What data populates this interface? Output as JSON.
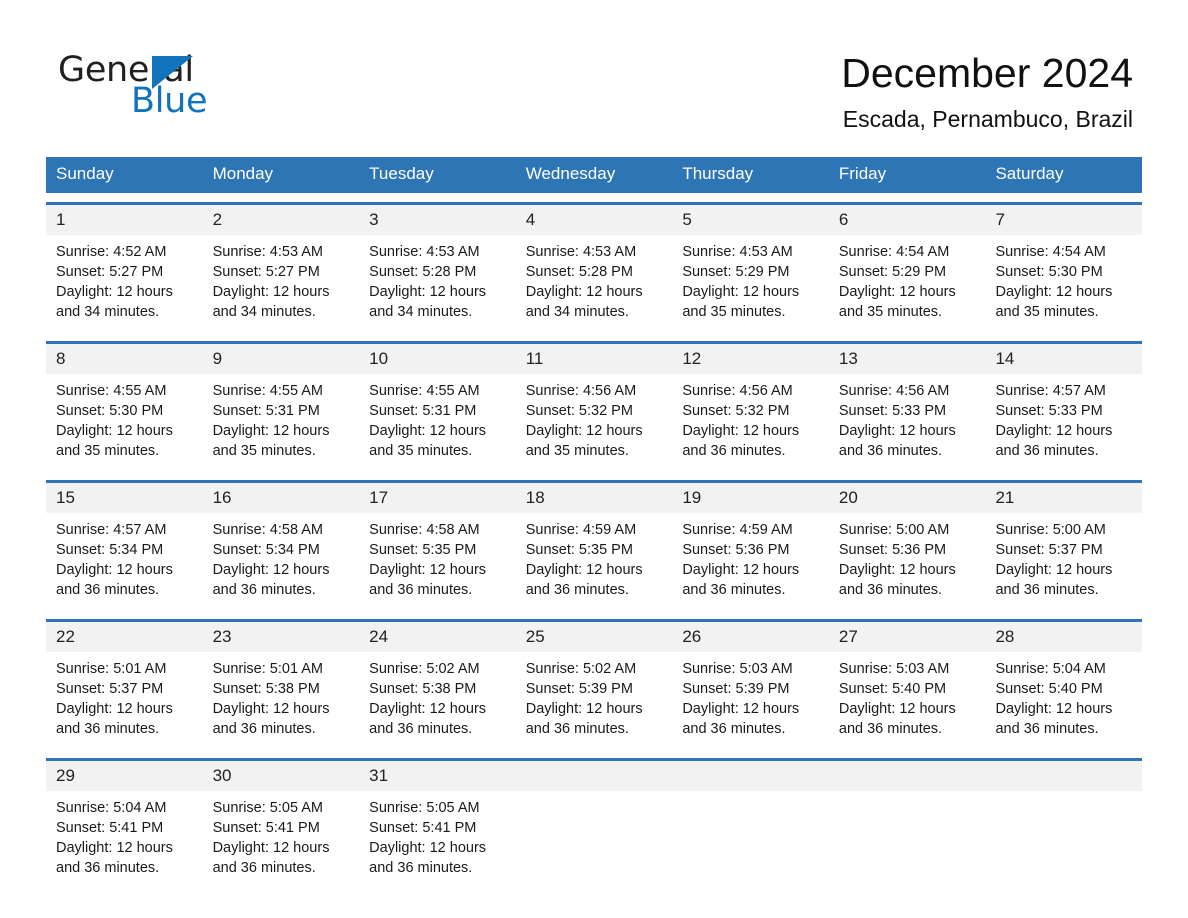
{
  "logo": {
    "word_black": "General",
    "word_blue": "Blue",
    "triangle_color": "#1273bd"
  },
  "header": {
    "title": "December 2024",
    "location": "Escada, Pernambuco, Brazil"
  },
  "theme": {
    "header_blue": "#2e75b6",
    "row_divider_blue": "#2e75b6",
    "date_band_gray": "#f2f2f2",
    "text_black": "#1a1a1a"
  },
  "weekdays": [
    "Sunday",
    "Monday",
    "Tuesday",
    "Wednesday",
    "Thursday",
    "Friday",
    "Saturday"
  ],
  "weeks": [
    [
      {
        "day": "1",
        "sunrise": "Sunrise: 4:52 AM",
        "sunset": "Sunset: 5:27 PM",
        "daylight_1": "Daylight: 12 hours",
        "daylight_2": "and 34 minutes."
      },
      {
        "day": "2",
        "sunrise": "Sunrise: 4:53 AM",
        "sunset": "Sunset: 5:27 PM",
        "daylight_1": "Daylight: 12 hours",
        "daylight_2": "and 34 minutes."
      },
      {
        "day": "3",
        "sunrise": "Sunrise: 4:53 AM",
        "sunset": "Sunset: 5:28 PM",
        "daylight_1": "Daylight: 12 hours",
        "daylight_2": "and 34 minutes."
      },
      {
        "day": "4",
        "sunrise": "Sunrise: 4:53 AM",
        "sunset": "Sunset: 5:28 PM",
        "daylight_1": "Daylight: 12 hours",
        "daylight_2": "and 34 minutes."
      },
      {
        "day": "5",
        "sunrise": "Sunrise: 4:53 AM",
        "sunset": "Sunset: 5:29 PM",
        "daylight_1": "Daylight: 12 hours",
        "daylight_2": "and 35 minutes."
      },
      {
        "day": "6",
        "sunrise": "Sunrise: 4:54 AM",
        "sunset": "Sunset: 5:29 PM",
        "daylight_1": "Daylight: 12 hours",
        "daylight_2": "and 35 minutes."
      },
      {
        "day": "7",
        "sunrise": "Sunrise: 4:54 AM",
        "sunset": "Sunset: 5:30 PM",
        "daylight_1": "Daylight: 12 hours",
        "daylight_2": "and 35 minutes."
      }
    ],
    [
      {
        "day": "8",
        "sunrise": "Sunrise: 4:55 AM",
        "sunset": "Sunset: 5:30 PM",
        "daylight_1": "Daylight: 12 hours",
        "daylight_2": "and 35 minutes."
      },
      {
        "day": "9",
        "sunrise": "Sunrise: 4:55 AM",
        "sunset": "Sunset: 5:31 PM",
        "daylight_1": "Daylight: 12 hours",
        "daylight_2": "and 35 minutes."
      },
      {
        "day": "10",
        "sunrise": "Sunrise: 4:55 AM",
        "sunset": "Sunset: 5:31 PM",
        "daylight_1": "Daylight: 12 hours",
        "daylight_2": "and 35 minutes."
      },
      {
        "day": "11",
        "sunrise": "Sunrise: 4:56 AM",
        "sunset": "Sunset: 5:32 PM",
        "daylight_1": "Daylight: 12 hours",
        "daylight_2": "and 35 minutes."
      },
      {
        "day": "12",
        "sunrise": "Sunrise: 4:56 AM",
        "sunset": "Sunset: 5:32 PM",
        "daylight_1": "Daylight: 12 hours",
        "daylight_2": "and 36 minutes."
      },
      {
        "day": "13",
        "sunrise": "Sunrise: 4:56 AM",
        "sunset": "Sunset: 5:33 PM",
        "daylight_1": "Daylight: 12 hours",
        "daylight_2": "and 36 minutes."
      },
      {
        "day": "14",
        "sunrise": "Sunrise: 4:57 AM",
        "sunset": "Sunset: 5:33 PM",
        "daylight_1": "Daylight: 12 hours",
        "daylight_2": "and 36 minutes."
      }
    ],
    [
      {
        "day": "15",
        "sunrise": "Sunrise: 4:57 AM",
        "sunset": "Sunset: 5:34 PM",
        "daylight_1": "Daylight: 12 hours",
        "daylight_2": "and 36 minutes."
      },
      {
        "day": "16",
        "sunrise": "Sunrise: 4:58 AM",
        "sunset": "Sunset: 5:34 PM",
        "daylight_1": "Daylight: 12 hours",
        "daylight_2": "and 36 minutes."
      },
      {
        "day": "17",
        "sunrise": "Sunrise: 4:58 AM",
        "sunset": "Sunset: 5:35 PM",
        "daylight_1": "Daylight: 12 hours",
        "daylight_2": "and 36 minutes."
      },
      {
        "day": "18",
        "sunrise": "Sunrise: 4:59 AM",
        "sunset": "Sunset: 5:35 PM",
        "daylight_1": "Daylight: 12 hours",
        "daylight_2": "and 36 minutes."
      },
      {
        "day": "19",
        "sunrise": "Sunrise: 4:59 AM",
        "sunset": "Sunset: 5:36 PM",
        "daylight_1": "Daylight: 12 hours",
        "daylight_2": "and 36 minutes."
      },
      {
        "day": "20",
        "sunrise": "Sunrise: 5:00 AM",
        "sunset": "Sunset: 5:36 PM",
        "daylight_1": "Daylight: 12 hours",
        "daylight_2": "and 36 minutes."
      },
      {
        "day": "21",
        "sunrise": "Sunrise: 5:00 AM",
        "sunset": "Sunset: 5:37 PM",
        "daylight_1": "Daylight: 12 hours",
        "daylight_2": "and 36 minutes."
      }
    ],
    [
      {
        "day": "22",
        "sunrise": "Sunrise: 5:01 AM",
        "sunset": "Sunset: 5:37 PM",
        "daylight_1": "Daylight: 12 hours",
        "daylight_2": "and 36 minutes."
      },
      {
        "day": "23",
        "sunrise": "Sunrise: 5:01 AM",
        "sunset": "Sunset: 5:38 PM",
        "daylight_1": "Daylight: 12 hours",
        "daylight_2": "and 36 minutes."
      },
      {
        "day": "24",
        "sunrise": "Sunrise: 5:02 AM",
        "sunset": "Sunset: 5:38 PM",
        "daylight_1": "Daylight: 12 hours",
        "daylight_2": "and 36 minutes."
      },
      {
        "day": "25",
        "sunrise": "Sunrise: 5:02 AM",
        "sunset": "Sunset: 5:39 PM",
        "daylight_1": "Daylight: 12 hours",
        "daylight_2": "and 36 minutes."
      },
      {
        "day": "26",
        "sunrise": "Sunrise: 5:03 AM",
        "sunset": "Sunset: 5:39 PM",
        "daylight_1": "Daylight: 12 hours",
        "daylight_2": "and 36 minutes."
      },
      {
        "day": "27",
        "sunrise": "Sunrise: 5:03 AM",
        "sunset": "Sunset: 5:40 PM",
        "daylight_1": "Daylight: 12 hours",
        "daylight_2": "and 36 minutes."
      },
      {
        "day": "28",
        "sunrise": "Sunrise: 5:04 AM",
        "sunset": "Sunset: 5:40 PM",
        "daylight_1": "Daylight: 12 hours",
        "daylight_2": "and 36 minutes."
      }
    ],
    [
      {
        "day": "29",
        "sunrise": "Sunrise: 5:04 AM",
        "sunset": "Sunset: 5:41 PM",
        "daylight_1": "Daylight: 12 hours",
        "daylight_2": "and 36 minutes."
      },
      {
        "day": "30",
        "sunrise": "Sunrise: 5:05 AM",
        "sunset": "Sunset: 5:41 PM",
        "daylight_1": "Daylight: 12 hours",
        "daylight_2": "and 36 minutes."
      },
      {
        "day": "31",
        "sunrise": "Sunrise: 5:05 AM",
        "sunset": "Sunset: 5:41 PM",
        "daylight_1": "Daylight: 12 hours",
        "daylight_2": "and 36 minutes."
      },
      {
        "day": "",
        "sunrise": "",
        "sunset": "",
        "daylight_1": "",
        "daylight_2": ""
      },
      {
        "day": "",
        "sunrise": "",
        "sunset": "",
        "daylight_1": "",
        "daylight_2": ""
      },
      {
        "day": "",
        "sunrise": "",
        "sunset": "",
        "daylight_1": "",
        "daylight_2": ""
      },
      {
        "day": "",
        "sunrise": "",
        "sunset": "",
        "daylight_1": "",
        "daylight_2": ""
      }
    ]
  ]
}
